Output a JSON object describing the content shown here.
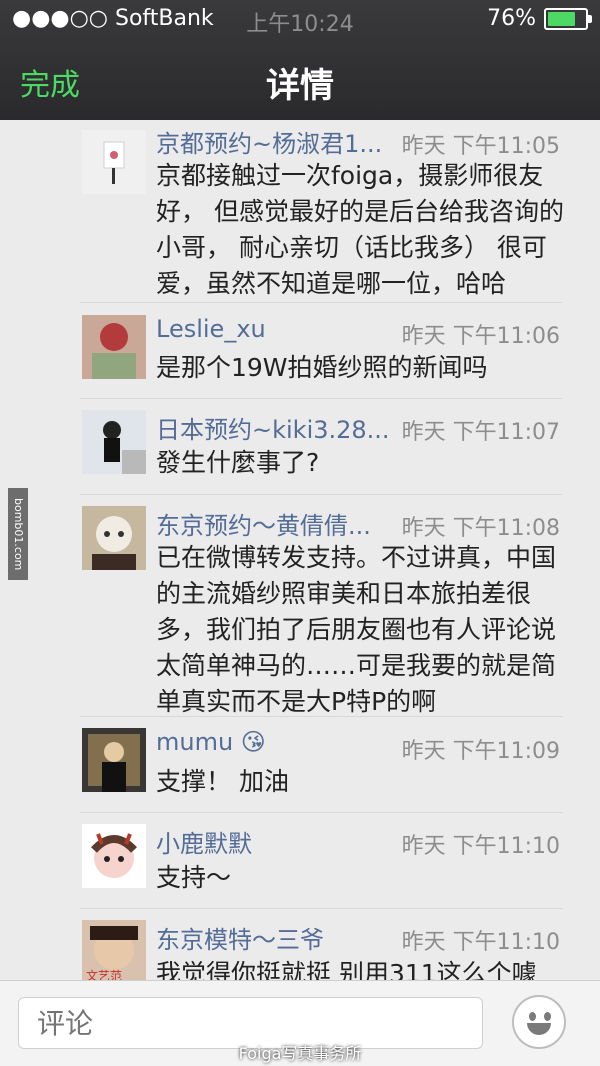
{
  "status_bar": {
    "carrier": "●●●○○ SoftBank",
    "time": "上午10:24",
    "battery": "76%",
    "battery_level": 0.76
  },
  "nav": {
    "done_label": "完成",
    "title": "详情"
  },
  "comments": [
    {
      "name": "京都预约~杨淑君1...",
      "time": "昨天  下午11:05",
      "text": "京都接触过一次foiga，摄影师很友好， 但感觉最好的是后台给我咨询的小哥， 耐心亲切（话比我多） 很可爱，虽然不知道是哪一位，哈哈"
    },
    {
      "name": "Leslie_xu",
      "time": "昨天  下午11:06",
      "text": "是那个19W拍婚纱照的新闻吗"
    },
    {
      "name": "日本预约~kiki3.28...",
      "time": "昨天  下午11:07",
      "text": "發生什麼事了?"
    },
    {
      "name": "东京预约～黄倩倩...",
      "time": "昨天  下午11:08",
      "text": "已在微博转发支持。不过讲真，中国的主流婚纱照审美和日本旅拍差很多，我们拍了后朋友圈也有人评论说太简单神马的……可是我要的就是简单真实而不是大P特P的啊"
    },
    {
      "name": "mumu 😘",
      "time": "昨天  下午11:09",
      "text": "支撑！ 加油"
    },
    {
      "name": "小鹿默默",
      "time": "昨天  下午11:10",
      "text": "支持～"
    },
    {
      "name": "东京模特～三爷",
      "time": "昨天  下午11:10",
      "text": "我觉得你挺就挺 别用311这么个噱"
    }
  ],
  "input": {
    "placeholder": "评论"
  },
  "side_tag": "bomb01.com",
  "watermark": "Foiga写真事务所"
}
